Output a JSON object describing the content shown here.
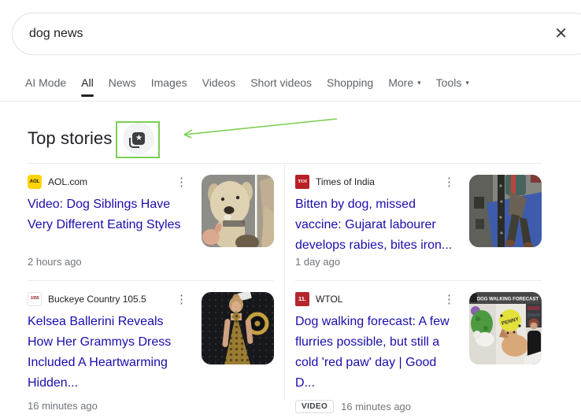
{
  "search": {
    "query": "dog news",
    "clear_icon": "✕"
  },
  "tabs": [
    {
      "label": "AI Mode"
    },
    {
      "label": "All"
    },
    {
      "label": "News"
    },
    {
      "label": "Images"
    },
    {
      "label": "Videos"
    },
    {
      "label": "Short videos"
    },
    {
      "label": "Shopping"
    },
    {
      "label": "More",
      "has_dropdown": true
    },
    {
      "label": "Tools",
      "has_dropdown": true
    }
  ],
  "active_tab": "All",
  "dropdown_icon": "▾",
  "menu_icon": "⋮",
  "top_stories": {
    "heading": "Top stories",
    "icon": "★"
  },
  "stories": [
    {
      "source": "AOL.com",
      "favicon_text": "AOL",
      "title": "Video: Dog Siblings Have Very Different Eating Styles",
      "time": "2 hours ago"
    },
    {
      "source": "Times of India",
      "favicon_text": "TOI",
      "title": "Bitten by dog, missed vaccine: Gujarat labourer develops rabies, bites iron...",
      "time": "1 day ago"
    },
    {
      "source": "Buckeye Country 105.5",
      "favicon_text": "1055",
      "title": "Kelsea Ballerini Reveals How Her Grammys Dress Included A Heartwarming Hidden...",
      "time": "16 minutes ago"
    },
    {
      "source": "WTOL",
      "favicon_text": "11.",
      "title": "Dog walking forecast: A few flurries possible, but still a cold 'red paw' day | Good D...",
      "time": "16 minutes ago",
      "badge": "VIDEO",
      "thumb_banner": "DOG WALKING FORECAST",
      "thumb_tag": "PENNY"
    }
  ],
  "colors": {
    "link_blue": "#1a0dab",
    "annotation_green": "#7ccf50",
    "aol_yellow": "#ffd400",
    "toi_red": "#b72025",
    "wtol_red": "#b3282d",
    "divider": "#ebebeb"
  }
}
